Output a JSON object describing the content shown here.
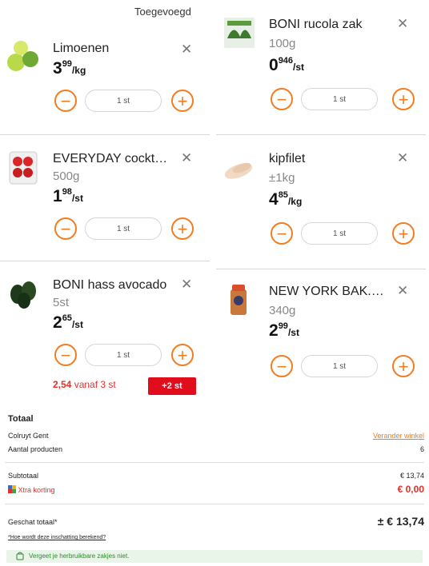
{
  "header": {
    "sort_label": "Toegevoegd"
  },
  "products": [
    {
      "name": "Limoenen",
      "subtitle": "",
      "price_int": "3",
      "price_dec": "99",
      "unit": "/kg",
      "qty": "1 st",
      "promo": null
    },
    {
      "name": "EVERYDAY cocktailtomaten",
      "subtitle": "500g",
      "price_int": "1",
      "price_dec": "98",
      "unit": "/st",
      "qty": "1 st",
      "promo": null
    },
    {
      "name": "BONI hass avocado",
      "subtitle": "5st",
      "price_int": "2",
      "price_dec": "65",
      "unit": "/st",
      "qty": "1 st",
      "promo": {
        "price": "2,54",
        "vanaf": "vanaf 3 st",
        "badge": "+2 st"
      }
    },
    {
      "name": "BONI rucola zak",
      "subtitle": "100g",
      "price_int": "0",
      "price_dec": "946",
      "unit": "/st",
      "qty": "1 st",
      "promo": null
    },
    {
      "name": "kipfilet",
      "subtitle": "±1kg",
      "price_int": "4",
      "price_dec": "85",
      "unit": "/kg",
      "qty": "1 st",
      "promo": null
    },
    {
      "name": "NEW YORK BAK.CHEESECAKE",
      "subtitle": "340g",
      "price_int": "2",
      "price_dec": "99",
      "unit": "/st",
      "qty": "1 st",
      "promo": null
    }
  ],
  "icons": {
    "close": "close-icon",
    "minus": "minus-icon",
    "plus": "plus-icon",
    "bag": "shopping-bag-icon"
  },
  "colors": {
    "accent": "#f47c20",
    "promo_red": "#e10d1d",
    "green": "#2b8a2b"
  },
  "summary": {
    "title": "Totaal",
    "store": "Colruyt Gent",
    "change_store": "Verander winkel",
    "count_label": "Aantal producten",
    "count_value": "6",
    "subtotal_label": "Subtotaal",
    "subtotal_value": "€ 13,74",
    "xtra_label": "Xtra korting",
    "xtra_value": "€ 0,00",
    "estimate_label": "Geschat totaal*",
    "estimate_value": "± € 13,74",
    "how_link": "*Hoe wordt deze inschatting berekend?",
    "bag_note": "Vergeet je herbruikbare zakjes niet."
  }
}
